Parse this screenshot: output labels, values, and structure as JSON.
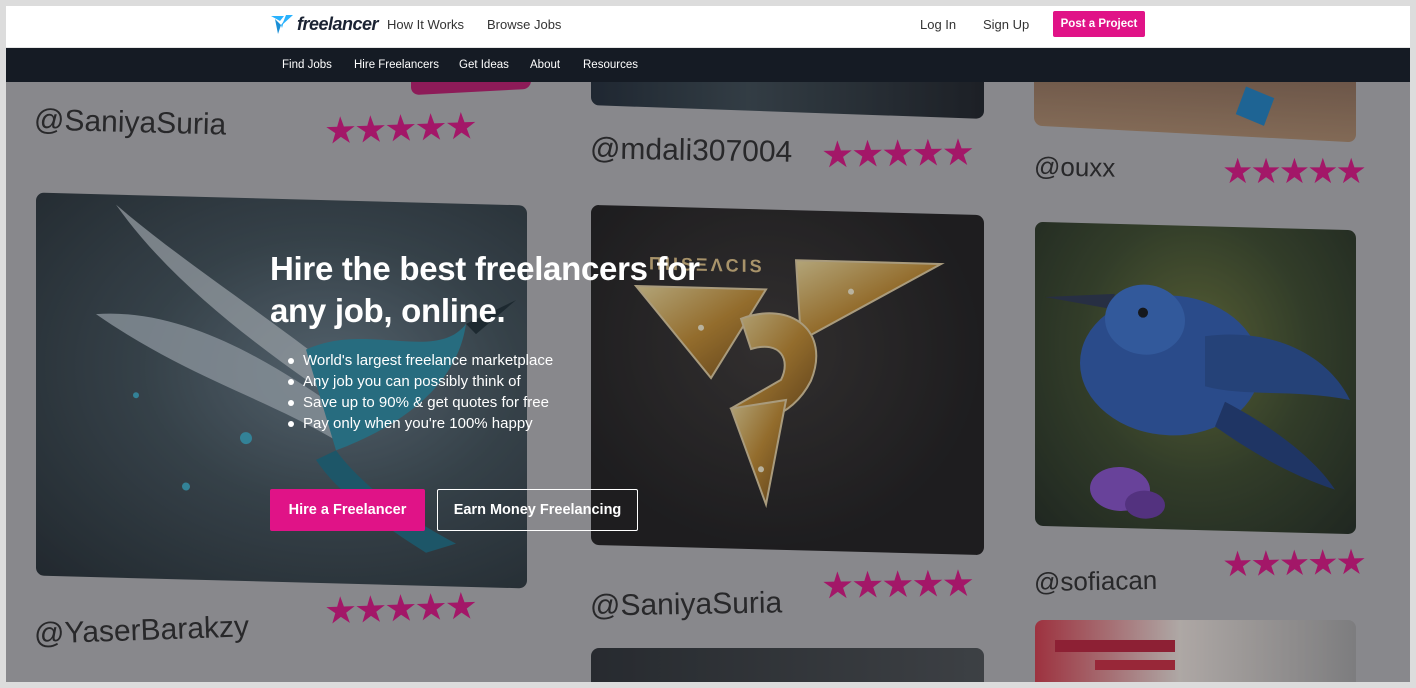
{
  "header": {
    "brand": "freelancer",
    "nav_how": "How It Works",
    "nav_browse": "Browse Jobs",
    "login": "Log In",
    "signup": "Sign Up",
    "post_project": "Post a Project"
  },
  "subnav": {
    "items": [
      "Find Jobs",
      "Hire Freelancers",
      "Get Ideas",
      "About",
      "Resources"
    ]
  },
  "gallery": {
    "handles": [
      "@SaniyaSuria",
      "@mdali307004",
      "@ouxx",
      "@YaserBarakzy",
      "@SaniyaSuria",
      "@sofiacan"
    ],
    "stars": "★★★★★",
    "card2_text": "ΠΙΙSΞΛCΙS"
  },
  "hero": {
    "headline": "Hire the best freelancers for any job, online.",
    "bullets": [
      "World's largest freelance marketplace",
      "Any job you can possibly think of",
      "Save up to 90% & get quotes for free",
      "Pay only when you're 100% happy"
    ],
    "hire_button": "Hire a Freelancer",
    "earn_button": "Earn Money Freelancing"
  },
  "colors": {
    "accent": "#e01387",
    "navbar": "#151b24",
    "logo_blue": "#29b2fe"
  }
}
